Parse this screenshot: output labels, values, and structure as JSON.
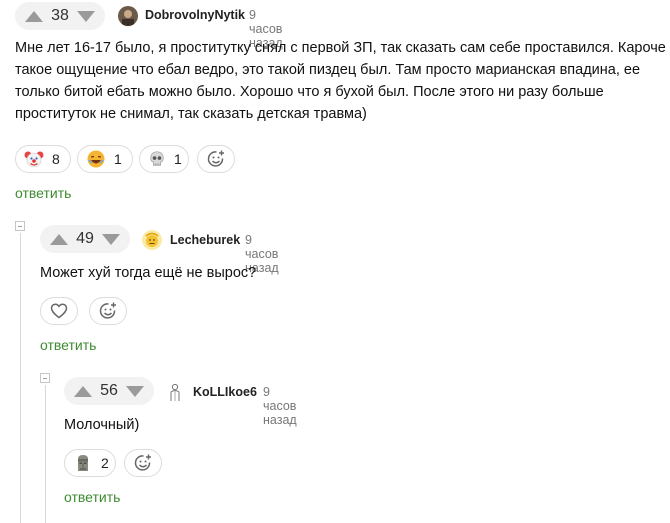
{
  "comments": [
    {
      "score": "38",
      "author": "DobrovolnyNytik",
      "time": "9 часов назад",
      "text_lines": [
        "Мне лет 16-17 было, я проститутку снял с первой ЗП, так сказать сам себе проставился. Кароче",
        "такое ощущение что ебал ведро, это такой пиздец был. Там просто марианская впадина, ее",
        "только битой ебать можно было. Хорошо что я бухой был. После этого ни разу больше",
        "проституток не снимал, так сказать детская травма)"
      ],
      "reactions": [
        {
          "icon": "clown-icon",
          "count": "8"
        },
        {
          "icon": "laughing-face-icon",
          "count": "1"
        },
        {
          "icon": "skull-icon",
          "count": "1"
        }
      ],
      "reply_label": "ответить"
    },
    {
      "score": "49",
      "author": "Lecheburek",
      "time": "9 часов назад",
      "text": "Может хуй тогда ещё не вырос?",
      "reply_label": "ответить"
    },
    {
      "score": "56",
      "author": "KoLLIkoe6",
      "time": "9 часов назад",
      "text": "Молочный)",
      "reactions": [
        {
          "icon": "moai-icon",
          "count": "2"
        }
      ],
      "reply_label": "ответить"
    }
  ]
}
